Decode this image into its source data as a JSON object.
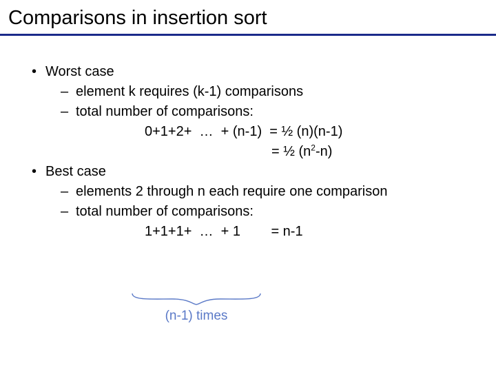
{
  "title": "Comparisons in insertion sort",
  "worst": {
    "head": "Worst case",
    "l1": "element k requires (k-1) comparisons",
    "l2": "total number of comparisons:",
    "eq": "0+1+2+  …  + (n-1)  = ½ (n)(n-1)",
    "eq2_pre": "= ½ (n",
    "eq2_sup": "2",
    "eq2_post": "-n)"
  },
  "best": {
    "head": "Best case",
    "l1": "elements 2 through n each require one comparison",
    "l2": "total number of comparisons:",
    "eq": "1+1+1+  …  + 1        = n-1"
  },
  "brace_label": "(n-1) times"
}
